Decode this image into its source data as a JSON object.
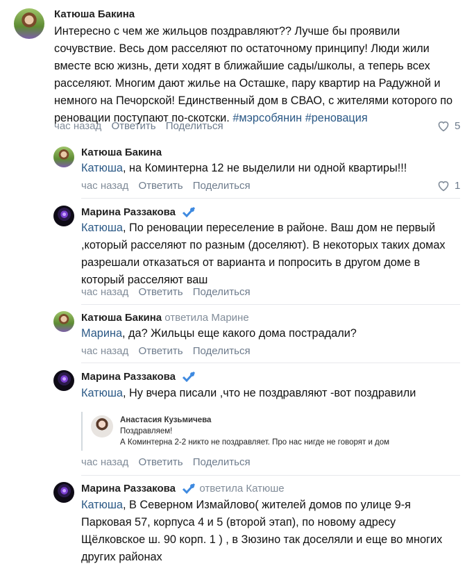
{
  "comments": [
    {
      "author": "Катюша Бакина",
      "lines": [
        "Интересно с чем же жильцов поздравляют?? Лучше бы проявили",
        "сочувствие. Весь дом расселяют по остаточному принципу! Люди жили",
        "вместе всю жизнь, дети ходят в ближайшие сады/школы, а теперь всех",
        "расселяют. Многим дают жилье на Осташке, пару квартир на Радужной и",
        "немного на Печорской! Единственный дом в СВАО, с жителями которого по",
        "реновации поступают по-скотски. "
      ],
      "hashtags": "#мэрсобянин #реновация",
      "time": "час назад",
      "reply": "Ответить",
      "share": "Поделиться",
      "likes": "5"
    },
    {
      "author": "Катюша Бакина",
      "mention": "Катюша",
      "lines": [
        ", на Коминтерна 12 не выделили ни одной квартиры!!!"
      ],
      "time": "час назад",
      "reply": "Ответить",
      "share": "Поделиться",
      "likes": "1"
    },
    {
      "author": "Марина Раззакова",
      "mention": "Катюша",
      "lines": [
        ", По реновации переселение в районе. Ваш дом не первый",
        ",который расселяют по разным (доселяют). В некоторых таких домах",
        "разрешали отказаться от варианта и попросить в другом доме в",
        "который расселяют ваш"
      ],
      "time": "час назад",
      "reply": "Ответить",
      "share": "Поделиться"
    },
    {
      "author": "Катюша Бакина",
      "replied_to": "ответила Марине",
      "mention": "Марина",
      "lines": [
        ", да? Жильцы еще какого дома пострадали?"
      ],
      "time": "час назад",
      "reply": "Ответить",
      "share": "Поделиться"
    },
    {
      "author": "Марина Раззакова",
      "mention": "Катюша",
      "lines": [
        ", Ну вчера писали ,что не поздравляют -вот поздравили"
      ],
      "quote": {
        "author": "Анастасия Кузьмичева",
        "line1": "Поздравляем!",
        "line2": "А Коминтерна 2-2 никто не поздравляет. Про нас нигде не говорят и дом"
      },
      "time": "час назад",
      "reply": "Ответить",
      "share": "Поделиться"
    },
    {
      "author": "Марина Раззакова",
      "replied_to": "ответила Катюше",
      "mention": "Катюша",
      "lines": [
        ", В Северном Измайлово( жителей домов по улице 9-я",
        "Парковая 57, корпуса 4 и 5 (второй этап), по новому адресу",
        "Щёлковское ш. 90 корп. 1 ) , в Зюзино так доселяли и еще во многих",
        "других районах"
      ]
    }
  ],
  "colors": {
    "link": "#2a5885",
    "meta": "#818c99",
    "verified": "#3f8ae0"
  },
  "icons": {
    "like": "heart-outline-icon",
    "verified": "verified-badge-icon"
  }
}
